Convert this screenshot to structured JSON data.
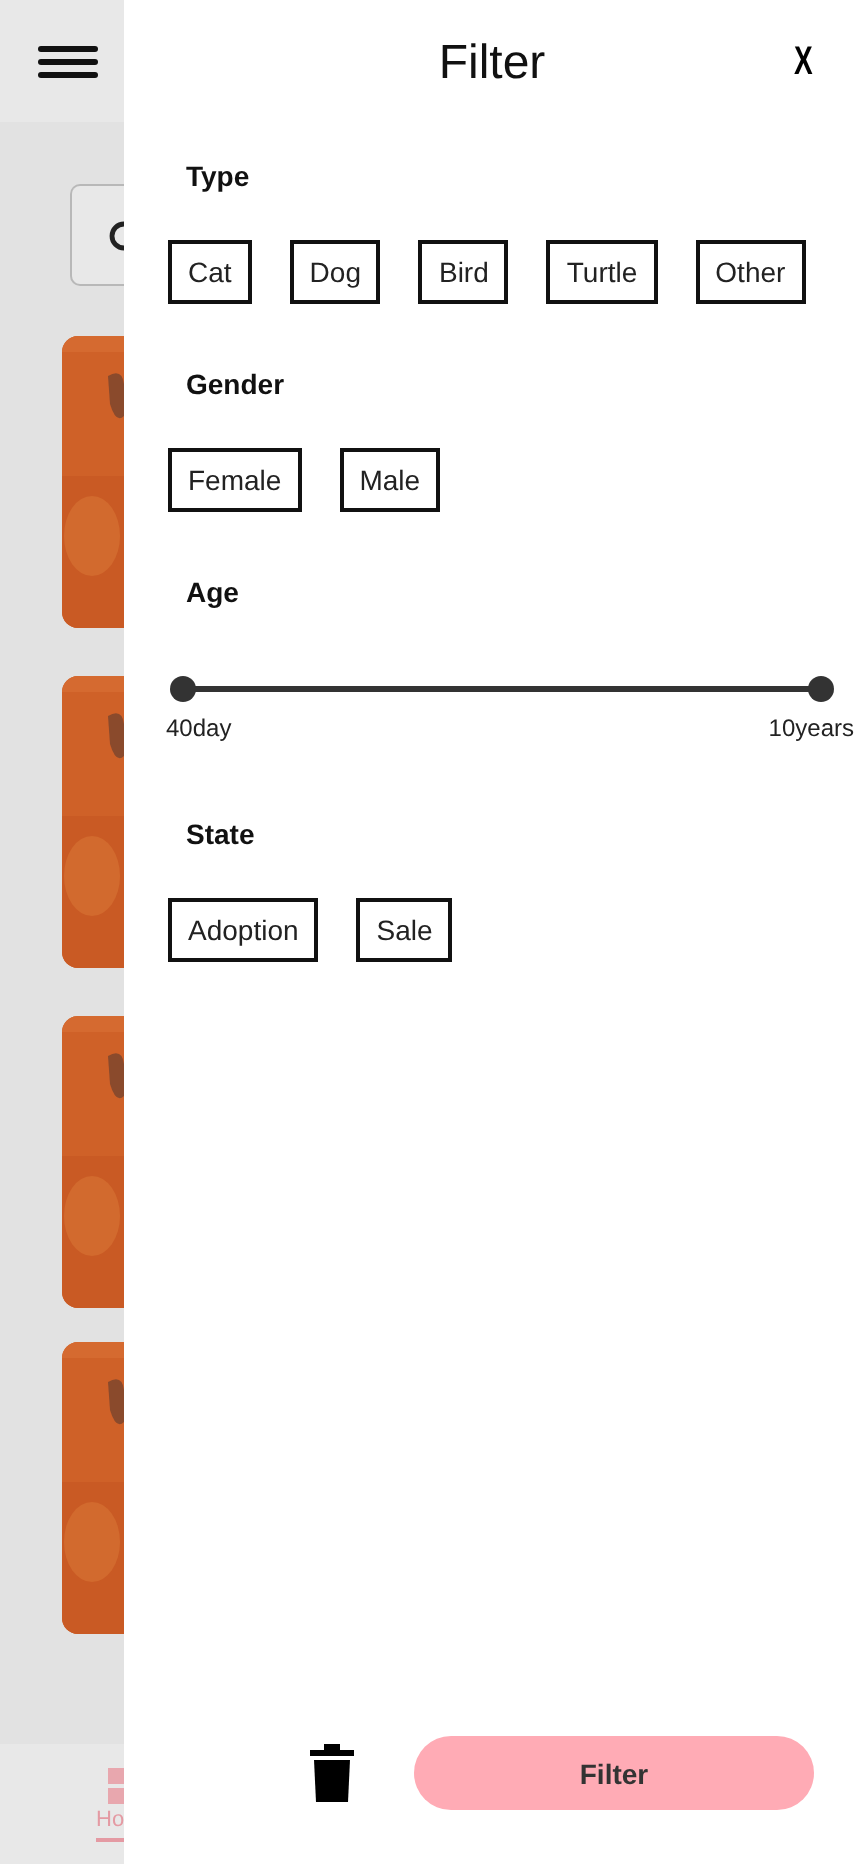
{
  "background": {
    "nav_label": "Ho"
  },
  "filter_panel": {
    "title": "Filter",
    "close": "X",
    "sections": [
      {
        "kind": "chips",
        "label": "Type",
        "options": [
          {
            "label": "Cat",
            "selected": false
          },
          {
            "label": "Dog",
            "selected": false
          },
          {
            "label": "Bird",
            "selected": false
          },
          {
            "label": "Turtle",
            "selected": false
          },
          {
            "label": "Other",
            "selected": false
          }
        ]
      },
      {
        "kind": "chips",
        "label": "Gender",
        "options": [
          {
            "label": "Female",
            "selected": false
          },
          {
            "label": "Male",
            "selected": false
          }
        ]
      },
      {
        "kind": "range",
        "label": "Age",
        "min_label": "40day",
        "max_label": "10years",
        "thumbs": [
          {
            "level": 0
          },
          {
            "level": 1
          }
        ]
      },
      {
        "kind": "chips",
        "label": "State",
        "options": [
          {
            "label": "Adoption",
            "selected": false
          },
          {
            "label": "Sale",
            "selected": false
          }
        ]
      }
    ],
    "apply_button": "Filter"
  }
}
